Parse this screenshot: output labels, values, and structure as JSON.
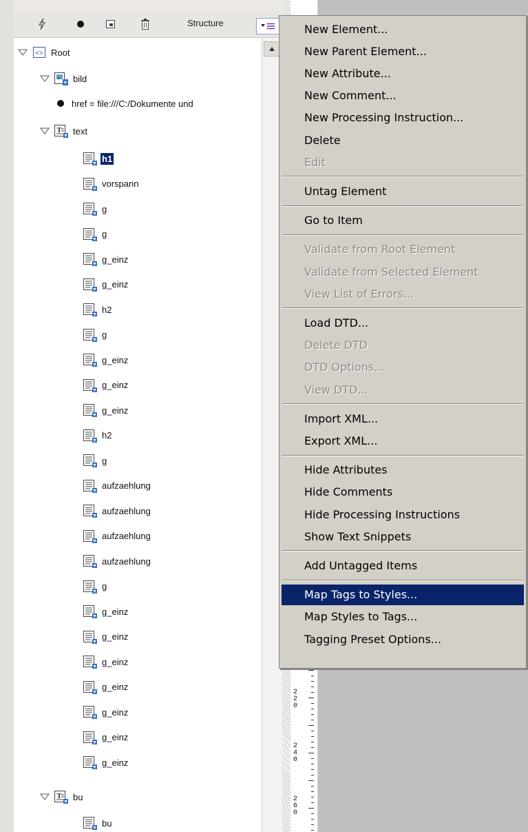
{
  "toolbar": {
    "structure_label": "Structure"
  },
  "tree": {
    "root_label": "Root",
    "bild_label": "bild",
    "attribute_text": "href = file:///C:/Dokumente und",
    "text_label": "text",
    "children": [
      "h1",
      "vorspann",
      "g",
      "g",
      "g_einz",
      "g_einz",
      "h2",
      "g",
      "g_einz",
      "g_einz",
      "g_einz",
      "h2",
      "g",
      "aufzaehlung",
      "aufzaehlung",
      "aufzaehlung",
      "aufzaehlung",
      "g",
      "g_einz",
      "g_einz",
      "g_einz",
      "g_einz",
      "g_einz",
      "g_einz",
      "g_einz"
    ],
    "selected_child": "h1",
    "bu_label": "bu",
    "bu_child": "bu"
  },
  "ruler": {
    "labels": [
      "220",
      "240",
      "260"
    ]
  },
  "context_menu": {
    "groups": [
      [
        {
          "label": "New Element...",
          "enabled": true
        },
        {
          "label": "New Parent Element...",
          "enabled": true
        },
        {
          "label": "New Attribute...",
          "enabled": true
        },
        {
          "label": "New Comment...",
          "enabled": true
        },
        {
          "label": "New Processing Instruction...",
          "enabled": true
        },
        {
          "label": "Delete",
          "enabled": true
        },
        {
          "label": "Edit",
          "enabled": false
        }
      ],
      [
        {
          "label": "Untag Element",
          "enabled": true
        }
      ],
      [
        {
          "label": "Go to Item",
          "enabled": true
        }
      ],
      [
        {
          "label": "Validate from Root Element",
          "enabled": false
        },
        {
          "label": "Validate from Selected Element",
          "enabled": false
        },
        {
          "label": "View List of Errors...",
          "enabled": false
        }
      ],
      [
        {
          "label": "Load DTD...",
          "enabled": true
        },
        {
          "label": "Delete DTD",
          "enabled": false
        },
        {
          "label": "DTD Options...",
          "enabled": false
        },
        {
          "label": "View DTD...",
          "enabled": false
        }
      ],
      [
        {
          "label": "Import XML...",
          "enabled": true
        },
        {
          "label": "Export XML...",
          "enabled": true
        }
      ],
      [
        {
          "label": "Hide Attributes",
          "enabled": true
        },
        {
          "label": "Hide Comments",
          "enabled": true
        },
        {
          "label": "Hide Processing Instructions",
          "enabled": true
        },
        {
          "label": "Show Text Snippets",
          "enabled": true
        }
      ],
      [
        {
          "label": "Add Untagged Items",
          "enabled": true
        }
      ],
      [
        {
          "label": "Map Tags to Styles...",
          "enabled": true,
          "highlighted": true
        },
        {
          "label": "Map Styles to Tags...",
          "enabled": true
        },
        {
          "label": "Tagging Preset Options...",
          "enabled": true
        }
      ]
    ]
  }
}
